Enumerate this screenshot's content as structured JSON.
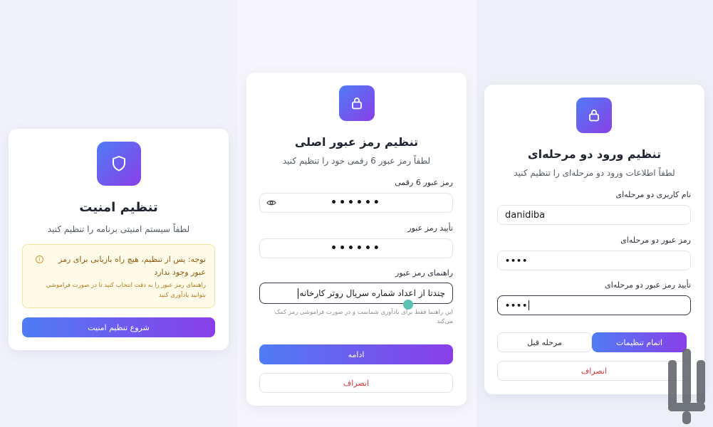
{
  "screen1": {
    "title": "تنظیم امنیت",
    "subtitle": "لطفاً سیستم امنیتی برنامه را تنظیم کنید",
    "warning_main": "توجه: پس از تنظیم، هیچ راه بازیابی برای رمز عبور وجود ندارد",
    "warning_sub": "راهنمای رمز عبور را به دقت انتخاب کنید تا در صورت فراموشی بتوانید یادآوری کنید",
    "start_button": "شروع تنظیم امنیت",
    "icon": "shield-icon"
  },
  "screen2": {
    "title": "تنظیم رمز عبور اصلی",
    "subtitle": "لطفاً رمز عبور 6 رقمی خود را تنظیم کنید",
    "password_label": "رمز عبور 6 رقمی",
    "password_value": "••••••",
    "confirm_label": "تأیید رمز عبور",
    "confirm_value": "••••••",
    "hint_label": "راهنمای رمز عبور",
    "hint_value": "چندتا از اعداد شماره سریال روتر کارخانه",
    "hint_note": "این راهنما فقط برای یادآوری شماست و در صورت فراموشی رمز کمک می‌کند",
    "continue_button": "ادامه",
    "cancel_button": "انصراف",
    "icon": "lock-icon"
  },
  "screen3": {
    "title": "تنظیم ورود دو مرحله‌ای",
    "subtitle": "لطفاً اطلاعات ورود دو مرحله‌ای را تنظیم کنید",
    "username_label": "نام کاربری دو مرحله‌ای",
    "username_value": "danidiba",
    "password_label": "رمز عبور دو مرحله‌ای",
    "password_value": "••••",
    "confirm_label": "تأیید رمز عبور دو مرحله‌ای",
    "confirm_value": "••••",
    "finish_button": "اتمام تنظیمات",
    "prev_button": "مرحله قبل",
    "cancel_button": "انصراف",
    "icon": "lock-icon"
  },
  "colors": {
    "accent_start": "#4f7cf5",
    "accent_end": "#8a3ee8",
    "cancel": "#d9363e",
    "warning_bg": "#fffbe8"
  }
}
